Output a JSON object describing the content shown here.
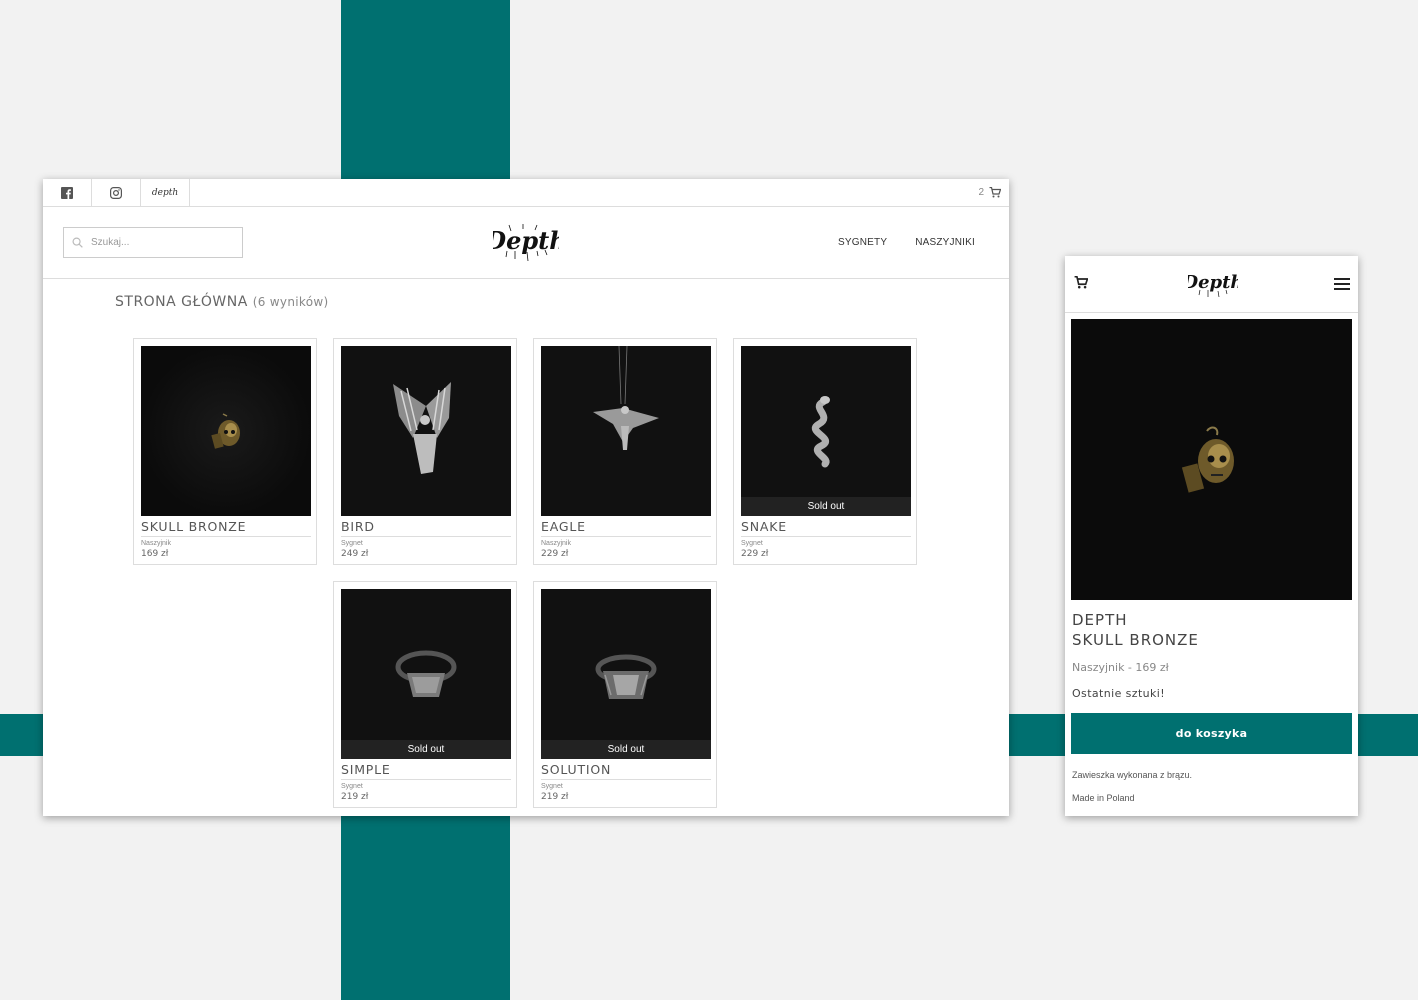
{
  "topbar": {
    "cart_count": "2",
    "brand_small": "depth"
  },
  "header": {
    "search_placeholder": "Szukaj...",
    "logo_text": "Depth",
    "nav": [
      "SYGNETY",
      "NASZYJNIKI"
    ]
  },
  "page": {
    "title": "STRONA GŁÓWNA",
    "results": "(6 wyników)"
  },
  "products": [
    {
      "name": "SKULL BRONZE",
      "category": "Naszyjnik",
      "price": "169 zł",
      "sold_out": ""
    },
    {
      "name": "BIRD",
      "category": "Sygnet",
      "price": "249 zł",
      "sold_out": ""
    },
    {
      "name": "EAGLE",
      "category": "Naszyjnik",
      "price": "229 zł",
      "sold_out": ""
    },
    {
      "name": "SNAKE",
      "category": "Sygnet",
      "price": "229 zł",
      "sold_out": "Sold out"
    },
    {
      "name": "SIMPLE",
      "category": "Sygnet",
      "price": "219 zł",
      "sold_out": "Sold out"
    },
    {
      "name": "SOLUTION",
      "category": "Sygnet",
      "price": "219 zł",
      "sold_out": "Sold out"
    }
  ],
  "mobile": {
    "logo_text": "Depth",
    "title_line1": "DEPTH",
    "title_line2": "SKULL BRONZE",
    "subtitle": "Naszyjnik - 169 zł",
    "stock": "Ostatnie sztuki!",
    "button": "do koszyka",
    "description": "Zawieszka wykonana z brązu.",
    "made_in": "Made in Poland"
  },
  "colors": {
    "accent": "#007070",
    "background": "#f2f2f2",
    "image_bg": "#0b0b0b"
  },
  "icons": [
    "facebook-icon",
    "instagram-icon",
    "cart-icon",
    "search-icon",
    "menu-icon"
  ]
}
